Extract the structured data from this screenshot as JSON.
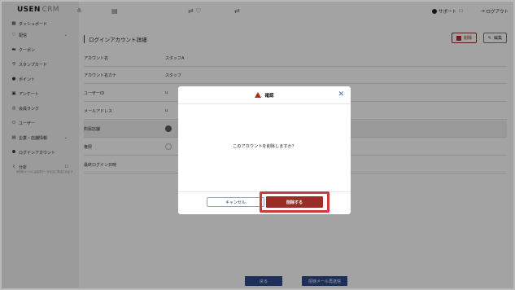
{
  "app": {
    "logo": "USEN",
    "logo_suffix": "CRM"
  },
  "sidebar": {
    "items": [
      {
        "label": "ダッシュボード",
        "icon": "dashboard-icon",
        "glyph": "▦"
      },
      {
        "label": "配信",
        "icon": "heart-icon",
        "glyph": "♡",
        "chevron": "⌄"
      },
      {
        "label": "クーポン",
        "icon": "coupon-icon",
        "glyph": "▬"
      },
      {
        "label": "スタンプカード",
        "icon": "stamp-icon",
        "glyph": "⚲"
      },
      {
        "label": "ポイント",
        "icon": "point-icon",
        "glyph": "●"
      },
      {
        "label": "アンケート",
        "icon": "survey-icon",
        "glyph": "▣"
      },
      {
        "label": "会員ランク",
        "icon": "rank-icon",
        "glyph": "◎"
      },
      {
        "label": "ユーザー",
        "icon": "users-icon",
        "glyph": "⚇"
      },
      {
        "label": "企業・店舗情報",
        "icon": "building-icon",
        "glyph": "▤",
        "chevron": "⌄"
      },
      {
        "label": "ログインアカウント",
        "icon": "account-icon",
        "glyph": "⚉"
      },
      {
        "label": "分析",
        "icon": "analysis-icon",
        "glyph": "⌇",
        "ext": "☐"
      }
    ],
    "analysis_note": "※分析ページには会員データを元に算出されます"
  },
  "topbar": {
    "support_label": "サポート",
    "support_ext": "☐",
    "logout_label": "ログアウト",
    "glyphs": [
      "≗",
      "▤",
      "⇄ ♡",
      "⇄"
    ]
  },
  "page": {
    "title": "ログインアカウント詳細",
    "delete_label": "削除",
    "edit_label": "編集",
    "fields": [
      {
        "label": "アカウント名",
        "value": "スタッフA"
      },
      {
        "label": "アカウント名カナ",
        "value": "スタッフ"
      },
      {
        "label": "ユーザーID",
        "value": "u"
      },
      {
        "label": "メールアドレス",
        "value": "u"
      },
      {
        "label": "所属店舗",
        "value": ""
      },
      {
        "label": "権限",
        "value": ""
      },
      {
        "label": "最終ログイン日時",
        "value": ""
      }
    ],
    "back_label": "戻る",
    "resend_label": "招待メール再送信"
  },
  "modal": {
    "title": "確認",
    "message": "このアカウントを削除しますか？",
    "cancel_label": "キャンセル",
    "confirm_label": "削除する",
    "close_glyph": "✕"
  },
  "colors": {
    "accent_blue": "#2f4a8d",
    "danger": "#9a2d26",
    "highlight": "#c63d3d"
  }
}
